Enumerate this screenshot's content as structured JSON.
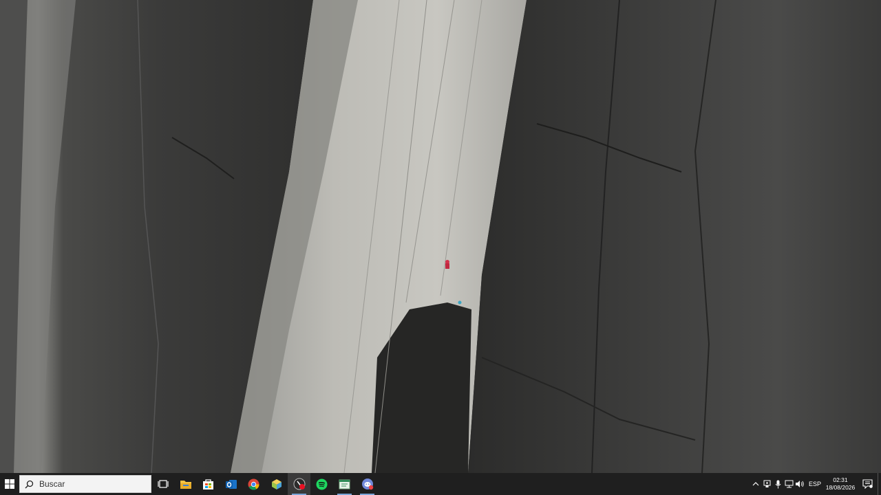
{
  "wallpaper": {
    "subject": ""
  },
  "taskbar": {
    "start_icon": "windows-logo-icon",
    "search": {
      "placeholder": "Buscar",
      "icon": "search-icon"
    },
    "pinned_apps": [
      {
        "name": "task-view",
        "icon": "task-view-icon"
      },
      {
        "name": "file-explorer",
        "icon": "folder-icon"
      },
      {
        "name": "microsoft-store",
        "icon": "store-icon"
      },
      {
        "name": "outlook",
        "icon": "outlook-icon"
      },
      {
        "name": "chrome",
        "icon": "chrome-icon"
      },
      {
        "name": "app-cube",
        "icon": "cube-icon"
      },
      {
        "name": "media-app",
        "icon": "media-icon",
        "active": true
      },
      {
        "name": "spotify",
        "icon": "spotify-icon"
      },
      {
        "name": "notepad",
        "icon": "notepad-icon"
      },
      {
        "name": "discord",
        "icon": "discord-icon"
      }
    ],
    "tray": {
      "icons": [
        "chevron-up-icon",
        "usb-icon",
        "microphone-icon",
        "network-icon",
        "volume-icon"
      ],
      "language": "ESP",
      "time": "02:31",
      "date": "18/08/2026",
      "notification_icon": "notification-center-icon"
    },
    "colors": {
      "background": "#1f1f1f",
      "accent": "#7aa5d8"
    }
  }
}
